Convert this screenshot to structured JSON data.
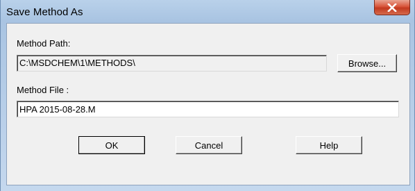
{
  "window": {
    "title": "Save Method As"
  },
  "form": {
    "path_label": "Method Path:",
    "path_value": "C:\\MSDCHEM\\1\\METHODS\\",
    "browse_label": "Browse...",
    "file_label": "Method File :",
    "file_value": "HPA 2015-08-28.M"
  },
  "buttons": {
    "ok": "OK",
    "cancel": "Cancel",
    "help": "Help"
  },
  "icons": {
    "close": "close-icon"
  },
  "colors": {
    "titlebar": "#b9d1ea",
    "close_button": "#c94a2e",
    "dialog_face": "#f0f0f0"
  }
}
